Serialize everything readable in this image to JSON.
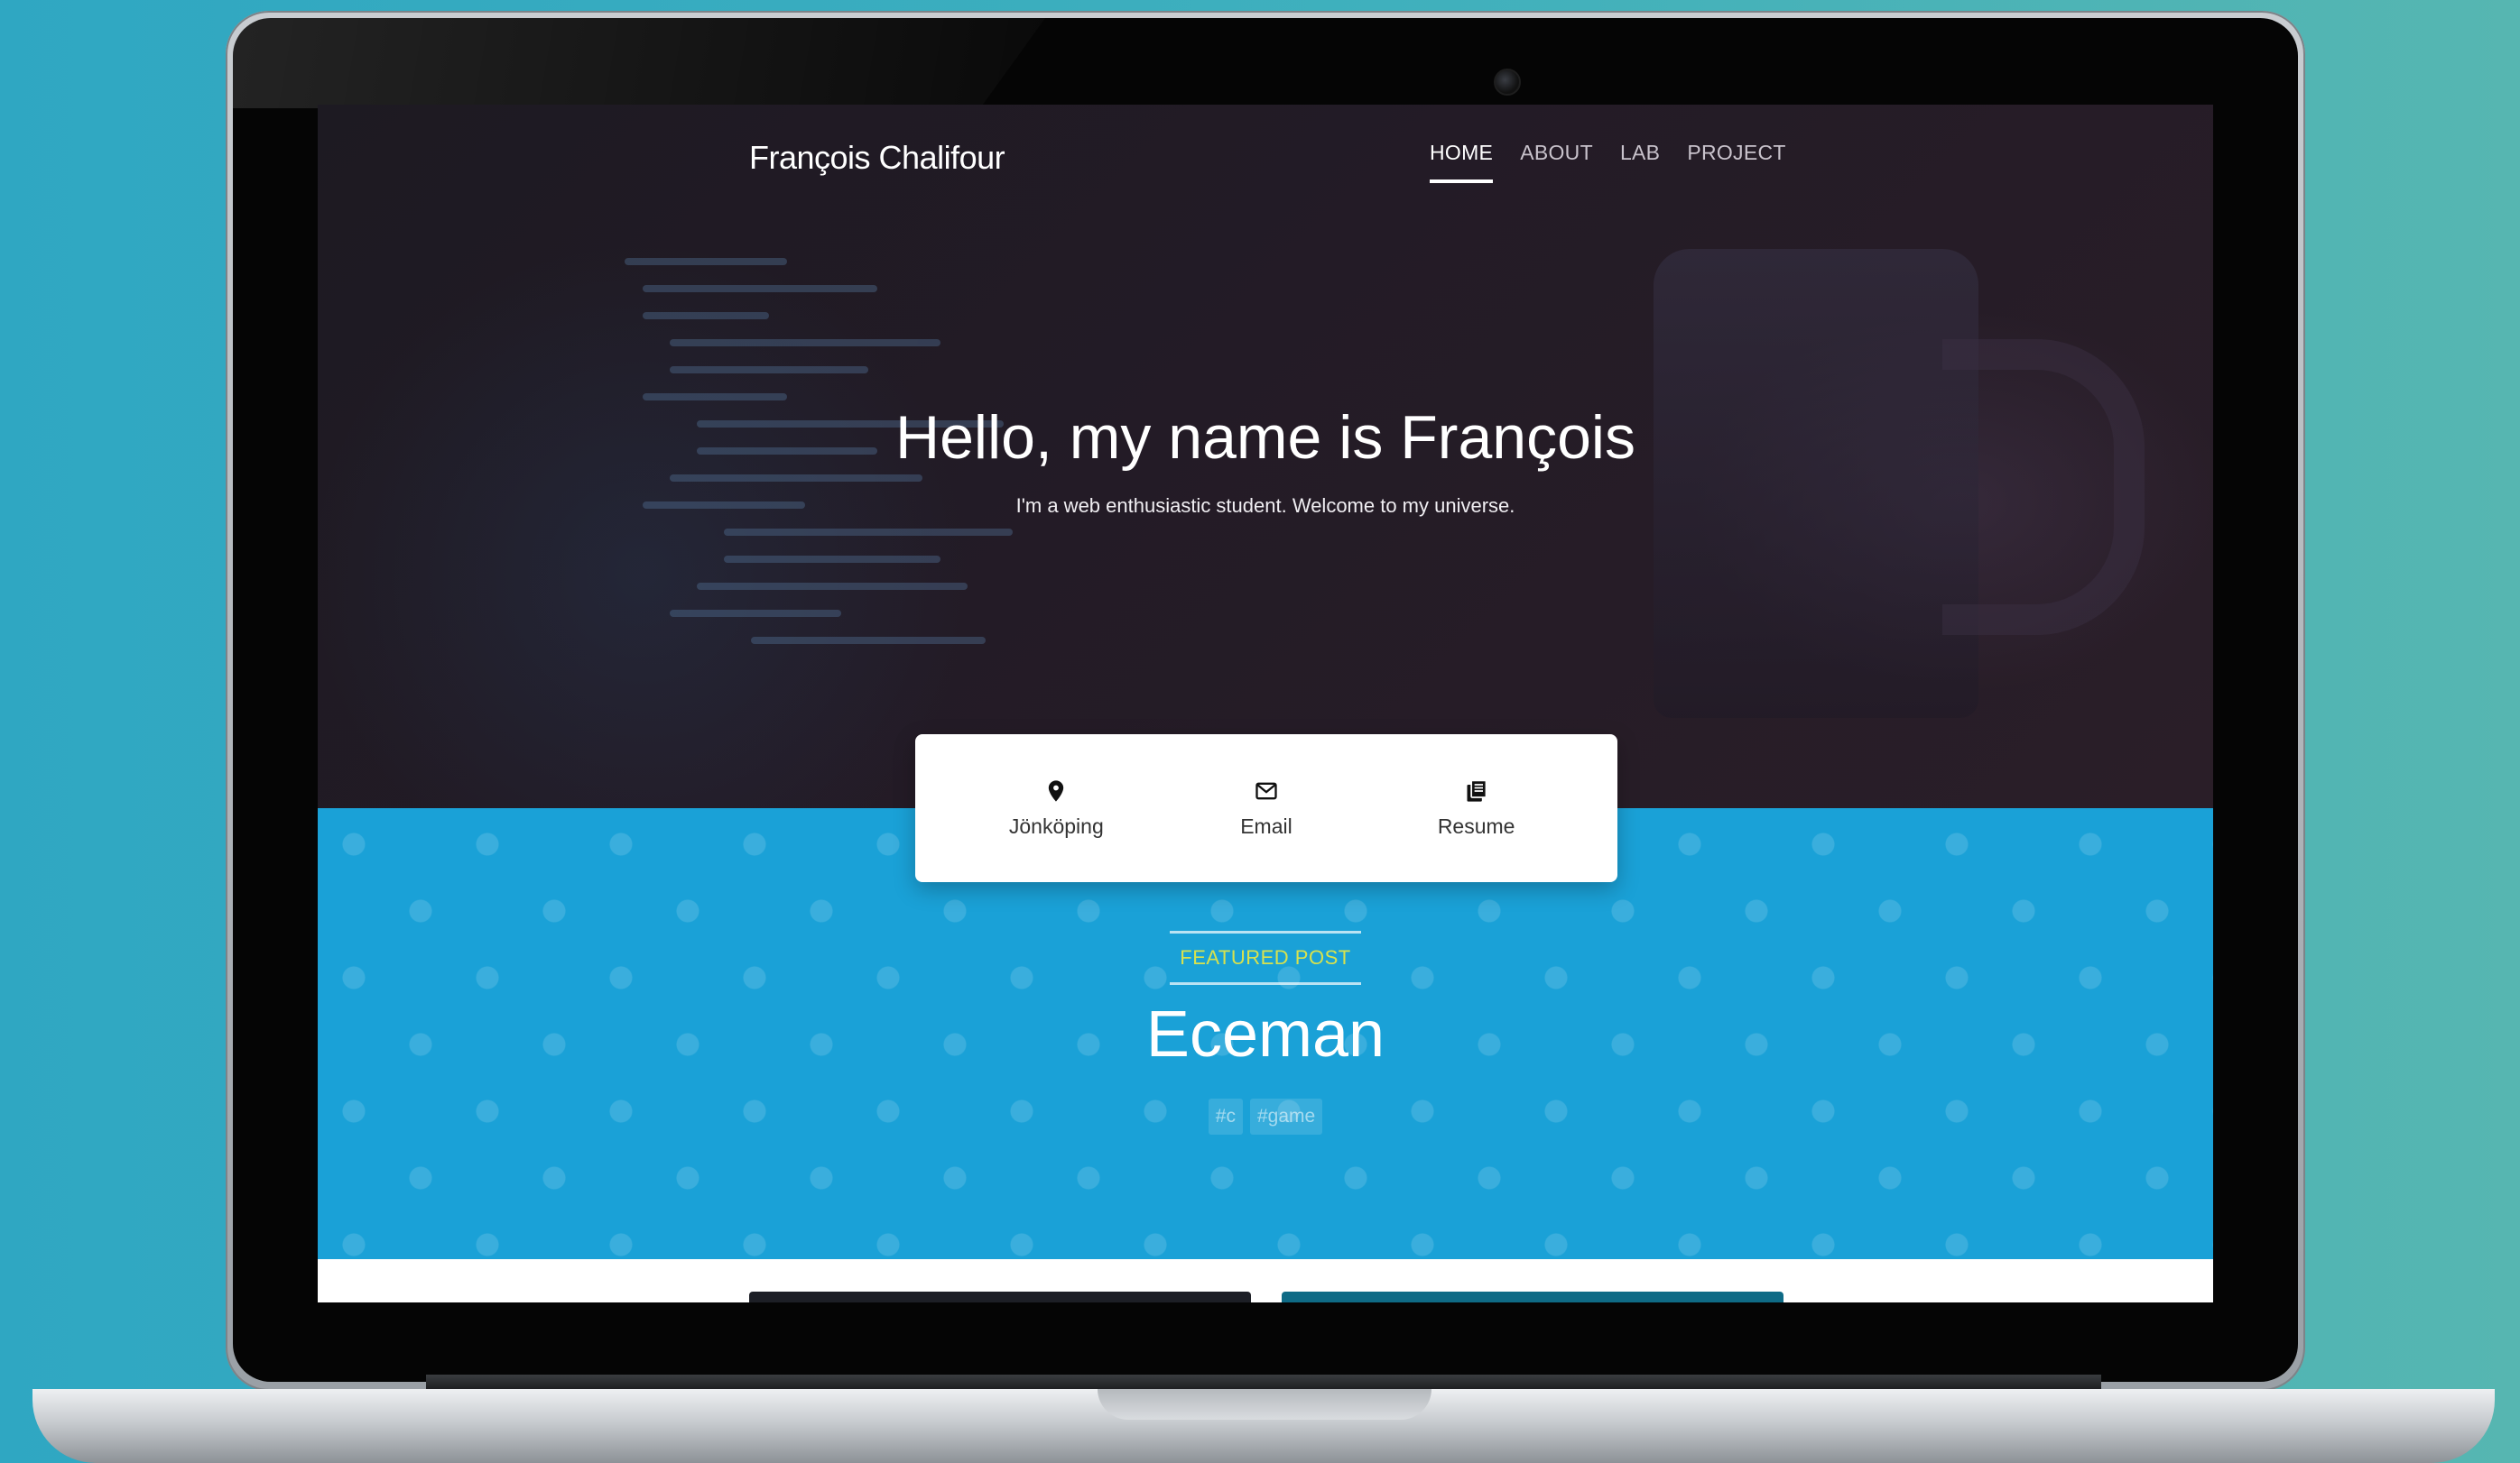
{
  "site": {
    "brand": "François Chalifour",
    "nav": [
      {
        "label": "HOME",
        "active": true
      },
      {
        "label": "ABOUT",
        "active": false
      },
      {
        "label": "LAB",
        "active": false
      },
      {
        "label": "PROJECT",
        "active": false
      }
    ]
  },
  "hero": {
    "heading": "Hello, my name is François",
    "tagline": "I'm a web enthusiastic student. Welcome to my universe."
  },
  "contacts": [
    {
      "label": "Jönköping",
      "icon": "map-pin-icon"
    },
    {
      "label": "Email",
      "icon": "envelope-icon"
    },
    {
      "label": "Resume",
      "icon": "document-stack-icon"
    }
  ],
  "featured": {
    "label": "FEATURED POST",
    "title": "Eceman",
    "tags": [
      "#c",
      "#game"
    ]
  },
  "colors": {
    "background": "#3aaec0",
    "hero_dark": "#211b25",
    "band_blue": "#1aa1d7",
    "featured_label": "#d8e24d"
  }
}
